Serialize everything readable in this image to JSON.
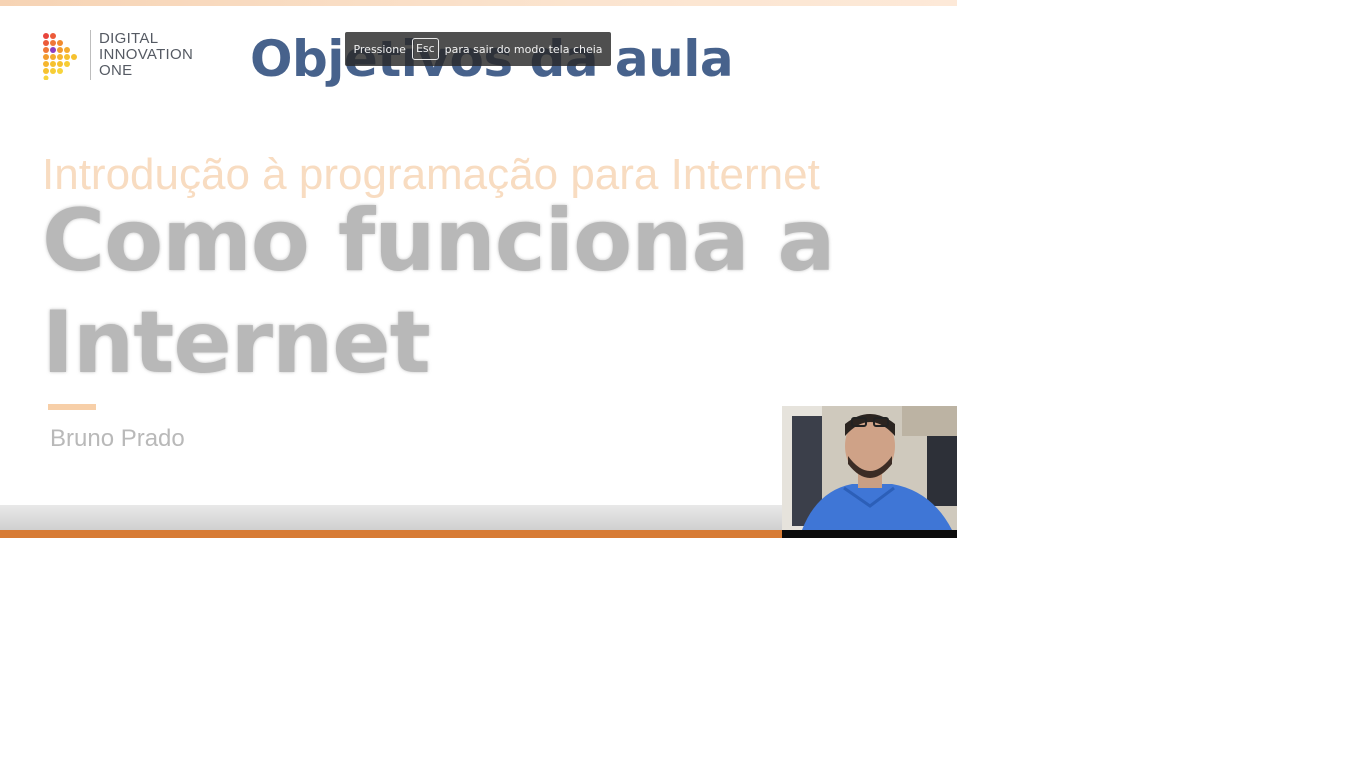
{
  "brand": {
    "lines": [
      "DIGITAL",
      "INNOVATION",
      "ONE"
    ],
    "logo_icon": "dio-triangle-dots-icon",
    "logo_colors": [
      "#e8453c",
      "#f28a2e",
      "#f6c12f",
      "#8e3fbf"
    ]
  },
  "slide": {
    "header": "Objetivos da aula",
    "course": "Introdução à programação para Internet",
    "title_line1": "Como funciona a",
    "title_line2": "Internet",
    "author": "Bruno Prado"
  },
  "fullscreen_notice": {
    "prefix": "Pressione",
    "key": "Esc",
    "suffix": "para sair do modo tela cheia"
  },
  "colors": {
    "header": "#3e5a86",
    "accent_orange": "#d77b35",
    "course_text": "#f8dcc1"
  },
  "webcam": {
    "icon": "presenter-webcam"
  }
}
